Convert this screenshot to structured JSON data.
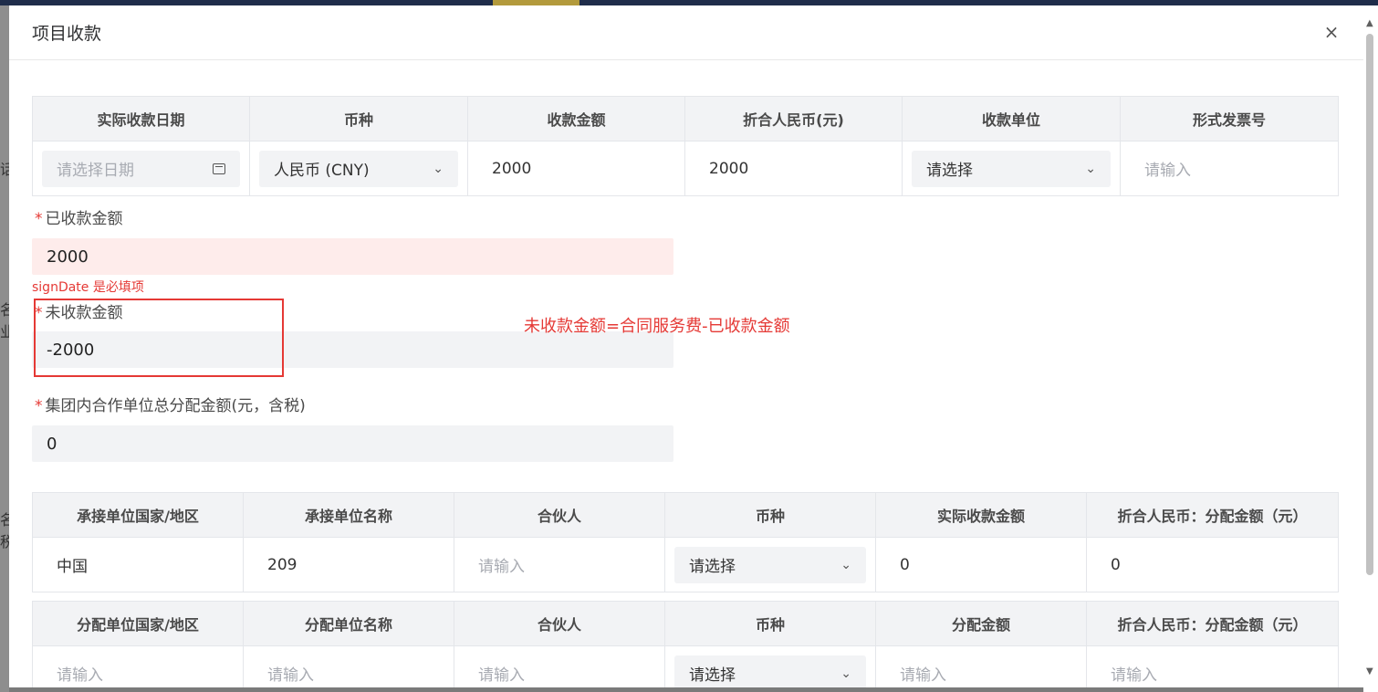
{
  "dialog": {
    "title": "项目收款",
    "close_label": "×"
  },
  "background_fragments": [
    "话",
    "名",
    "业",
    "名",
    "税"
  ],
  "payment_table": {
    "headers": [
      "实际收款日期",
      "币种",
      "收款金额",
      "折合人民币(元)",
      "收款单位",
      "形式发票号"
    ],
    "row": {
      "date_placeholder": "请选择日期",
      "currency": "人民币 (CNY)",
      "amount": "2000",
      "rmb_amount": "2000",
      "unit_placeholder": "请选择",
      "invoice_placeholder": "请输入"
    }
  },
  "form": {
    "received": {
      "required": "*",
      "label": "已收款金额",
      "value": "2000",
      "error": "signDate 是必填项"
    },
    "unreceived": {
      "required": "*",
      "label": "未收款金额",
      "value": "-2000"
    },
    "group_total": {
      "required": "*",
      "label": "集团内合作单位总分配金额(元，含税)",
      "value": "0"
    }
  },
  "annotation": {
    "note": "未收款金额=合同服务费-已收款金额",
    "color": "#e53935"
  },
  "undertaking_table": {
    "headers": [
      "承接单位国家/地区",
      "承接单位名称",
      "合伙人",
      "币种",
      "实际收款金额",
      "折合人民币：分配金额（元）"
    ],
    "row": {
      "country": "中国",
      "name": "209",
      "partner_placeholder": "请输入",
      "currency_placeholder": "请选择",
      "actual_amount": "0",
      "rmb_amount": "0"
    }
  },
  "allocation_table": {
    "headers": [
      "分配单位国家/地区",
      "分配单位名称",
      "合伙人",
      "币种",
      "分配金额",
      "折合人民币：分配金额（元）"
    ],
    "row": {
      "country_placeholder": "请输入",
      "name_placeholder": "请输入",
      "partner_placeholder": "请输入",
      "currency_placeholder": "请选择",
      "amount_placeholder": "请输入",
      "rmb_placeholder": "请输入"
    }
  },
  "icons": {
    "chevron": "chevron-down-icon",
    "calendar": "calendar-icon",
    "close": "close-icon"
  },
  "colors": {
    "error": "#e53935",
    "header_bg": "#f2f3f5",
    "error_bg": "#feeceb"
  }
}
